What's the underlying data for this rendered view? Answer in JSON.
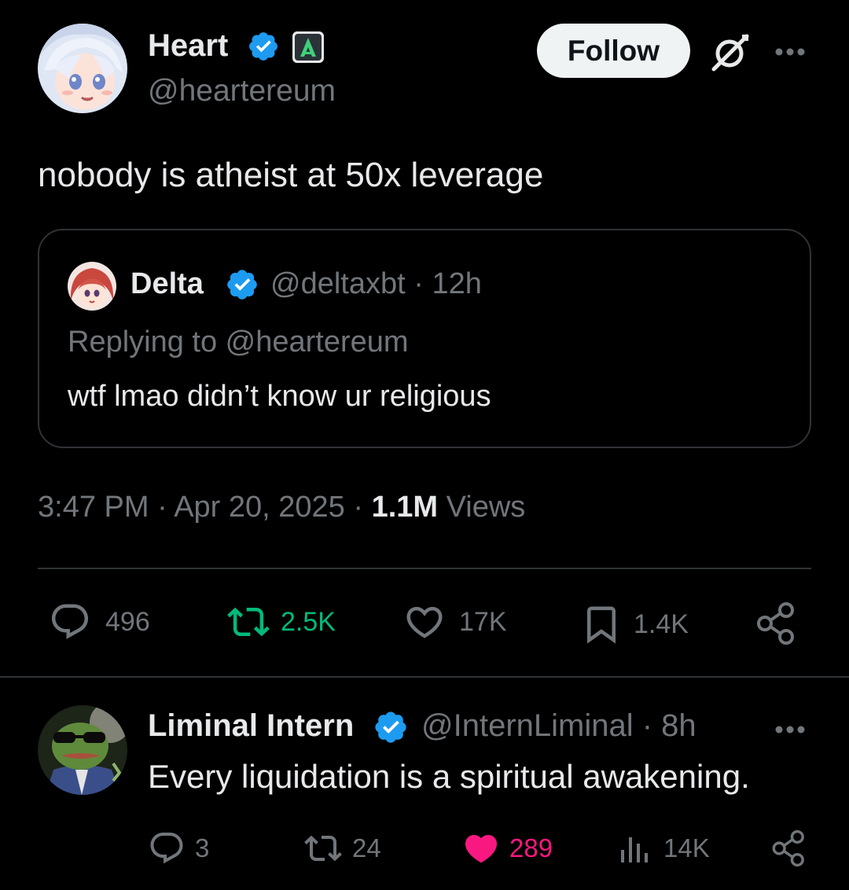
{
  "main_tweet": {
    "display_name": "Heart",
    "handle": "@heartereum",
    "follow_label": "Follow",
    "text": "nobody is atheist at 50x leverage",
    "timestamp": "3:47 PM · Apr 20, 2025 · ",
    "views_count": "1.1M",
    "views_label": " Views",
    "stats": {
      "replies": "496",
      "reposts": "2.5K",
      "likes": "17K",
      "bookmarks": "1.4K"
    },
    "icons": {
      "verified": "verified-badge-icon",
      "affiliation": "affiliation-badge-icon",
      "grok": "grok-icon",
      "more": "more-dots-icon"
    }
  },
  "quoted_tweet": {
    "display_name": "Delta",
    "handle_and_time": "@deltaxbt · 12h",
    "replying_to": "Replying to @heartereum",
    "text": "wtf lmao didn’t know ur religious"
  },
  "reply": {
    "display_name": "Liminal Intern",
    "handle_and_time": "@InternLiminal · 8h",
    "text": "Every liquidation is a spiritual awakening.",
    "stats": {
      "replies": "3",
      "reposts": "24",
      "likes": "289",
      "views": "14K"
    },
    "liked": true
  },
  "colors": {
    "background": "#000000",
    "text_primary": "#e7e9ea",
    "text_secondary": "#71767b",
    "verified_blue": "#1d9bf0",
    "repost_green": "#00ba7c",
    "like_pink": "#f91880",
    "divider": "#2f3336",
    "follow_button_bg": "#eff3f4"
  }
}
